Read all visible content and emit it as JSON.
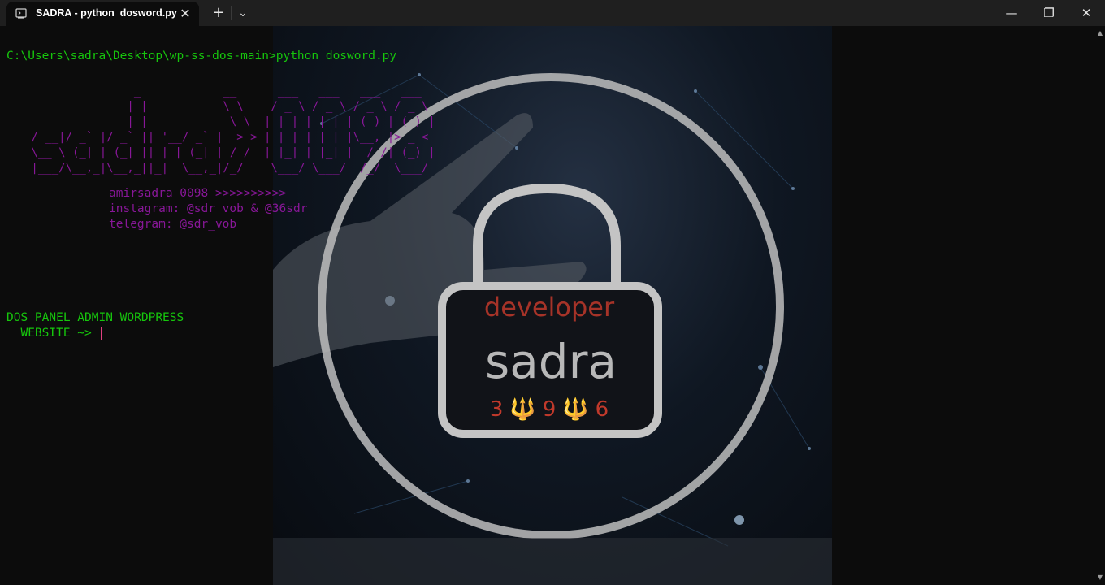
{
  "window": {
    "tab_title": "SADRA - python  dosword.py",
    "tab_close": "✕",
    "new_tab": "+",
    "dropdown": "⌄",
    "minimize": "—",
    "maximize": "❐",
    "close": "✕"
  },
  "terminal": {
    "command_line": "C:\\Users\\sadra\\Desktop\\wp-ss-dos-main>python dosword.py",
    "banner": "                _            __      ___   ___   ___   ___\n               | |           \\ \\    / _ \\ / _ \\ / _ \\ / _ \\\n  ___  __ _  __| | _ __ __ _  \\ \\  | | | | | | | (_) | (_) |\n / __|/ _` |/ _` || '__/ _` |  > > | | | | | | |\\__, |> _ <\n \\__ \\ (_| | (_| || | | (_| | / /  | |_| | |_| |  / /| (_) |\n |___/\\__,_|\\__,_||_|  \\__,_|/_/    \\___/ \\___/  /_/  \\___/",
    "credits": [
      "amirsadra 0098 >>>>>>>>>>",
      "instagram: @sdr_vob & @36sdr",
      "telegram: @sdr_vob"
    ],
    "panel_title": "DOS PANEL ADMIN WORDPRESS",
    "prompt": "  WEBSITE ~> "
  },
  "background_image": {
    "text_developer": "developer",
    "text_name": "sadra",
    "text_numbers": "3🔱9🔱6"
  },
  "colors": {
    "terminal_bg": "#0c0c0c",
    "green": "#16c60c",
    "purple": "#881798",
    "titlebar": "#1f1f1f"
  },
  "scrollbar": {
    "up": "▲",
    "down": "▼"
  }
}
